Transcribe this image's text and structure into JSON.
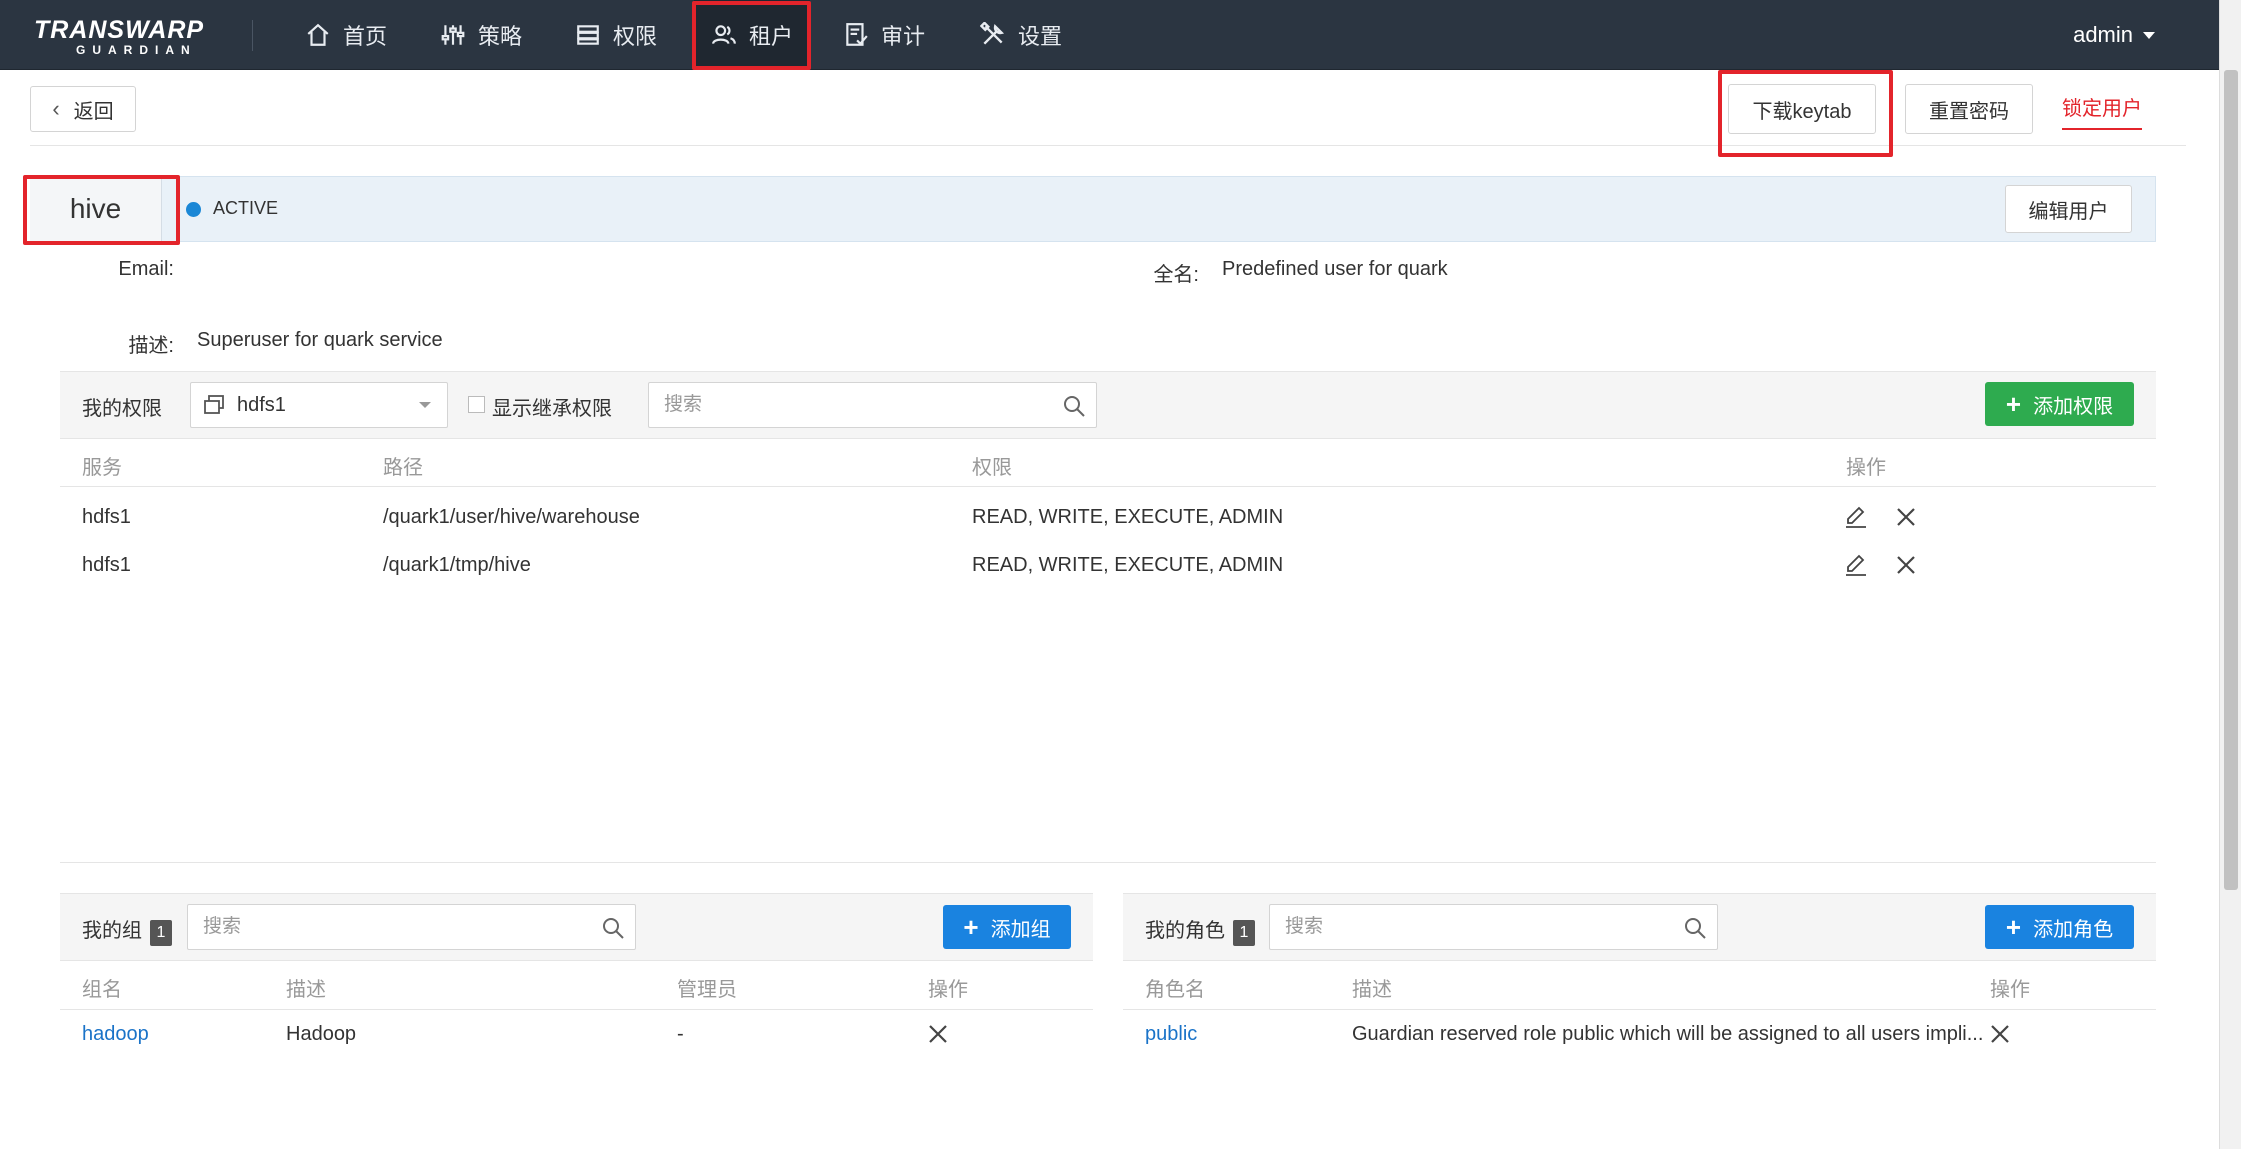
{
  "logo": {
    "main": "TRANSWARP",
    "sub": "GUARDIAN"
  },
  "nav": {
    "items": [
      {
        "label": "首页",
        "icon": "home-icon"
      },
      {
        "label": "策略",
        "icon": "sliders-icon"
      },
      {
        "label": "权限",
        "icon": "server-icon"
      },
      {
        "label": "租户",
        "icon": "users-icon",
        "active": true
      },
      {
        "label": "审计",
        "icon": "audit-icon"
      },
      {
        "label": "设置",
        "icon": "tools-icon"
      }
    ],
    "user": "admin"
  },
  "actions": {
    "back": "返回",
    "download_keytab": "下载keytab",
    "reset_password": "重置密码",
    "lock_user": "锁定用户"
  },
  "user": {
    "name": "hive",
    "status": "ACTIVE",
    "edit_button": "编辑用户",
    "email_label": "Email:",
    "email_value": "",
    "fullname_label": "全名:",
    "fullname_value": "Predefined user for quark",
    "desc_label": "描述:",
    "desc_value": "Superuser for quark service"
  },
  "permissions": {
    "title": "我的权限",
    "service_select": "hdfs1",
    "inherit_label": "显示继承权限",
    "search_placeholder": "搜索",
    "add_button": "添加权限",
    "columns": [
      "服务",
      "路径",
      "权限",
      "操作"
    ],
    "rows": [
      {
        "service": "hdfs1",
        "path": "/quark1/user/hive/warehouse",
        "perms": "READ, WRITE, EXECUTE, ADMIN"
      },
      {
        "service": "hdfs1",
        "path": "/quark1/tmp/hive",
        "perms": "READ, WRITE, EXECUTE, ADMIN"
      }
    ]
  },
  "groups": {
    "title": "我的组",
    "count": "1",
    "search_placeholder": "搜索",
    "add_button": "添加组",
    "columns": [
      "组名",
      "描述",
      "管理员",
      "操作"
    ],
    "rows": [
      {
        "name": "hadoop",
        "desc": "Hadoop",
        "admin": "-"
      }
    ]
  },
  "roles": {
    "title": "我的角色",
    "count": "1",
    "search_placeholder": "搜索",
    "add_button": "添加角色",
    "columns": [
      "角色名",
      "描述",
      "操作"
    ],
    "rows": [
      {
        "name": "public",
        "desc": "Guardian reserved role public which will be assigned to all users impli..."
      }
    ]
  },
  "colors": {
    "topbar": "#2b3541",
    "accent_blue": "#1a83e0",
    "accent_green": "#2eab4f",
    "danger": "#e3242b",
    "link": "#1a73c8"
  }
}
